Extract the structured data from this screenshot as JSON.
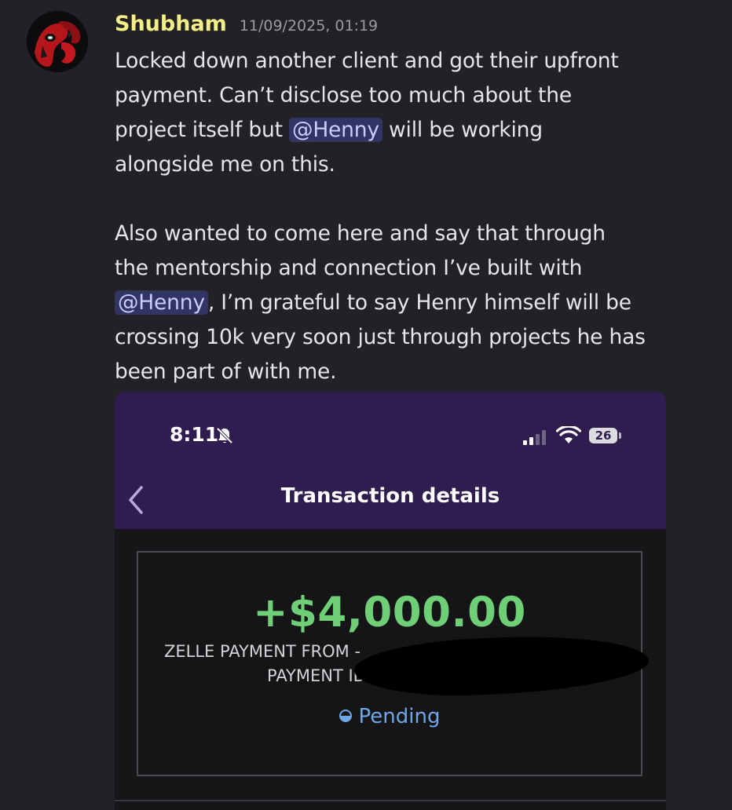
{
  "message": {
    "username": "Shubham",
    "timestamp": "11/09/2025, 01:19",
    "avatar_icon": "deadpool-avatar-icon",
    "lines": {
      "l1": "Locked down another client and got their upfront",
      "l2": "payment. Can’t disclose too much about the",
      "l3_before": "project itself but ",
      "l3_after": " will be working",
      "l4": "alongside me on this.",
      "l6": "Also wanted to come here and say that through",
      "l7": "the mentorship and connection I’ve built with",
      "l8_after": ", I’m grateful to say Henry himself will be",
      "l9": "crossing 10k very soon just through projects he has",
      "l10": "been part of with me."
    },
    "mention": "@Henny"
  },
  "attachment": {
    "status_bar": {
      "time": "8:11",
      "battery": "26",
      "icons": [
        "bell-slash-icon",
        "signal-icon",
        "wifi-icon",
        "battery-icon"
      ]
    },
    "nav": {
      "title": "Transaction details",
      "back_icon": "chevron-left-icon"
    },
    "transaction": {
      "amount": "+$4,000.00",
      "memo_line1": "ZELLE PAYMENT FROM - ",
      "memo_line2": "PAYMENT ID ",
      "status": "Pending"
    }
  },
  "colors": {
    "background": "#222226",
    "username": "#f4ef86",
    "mention_bg": "#3d4270",
    "phone_header": "#2f1d50",
    "amount": "#6fcf77",
    "pending": "#6fa6e8"
  }
}
